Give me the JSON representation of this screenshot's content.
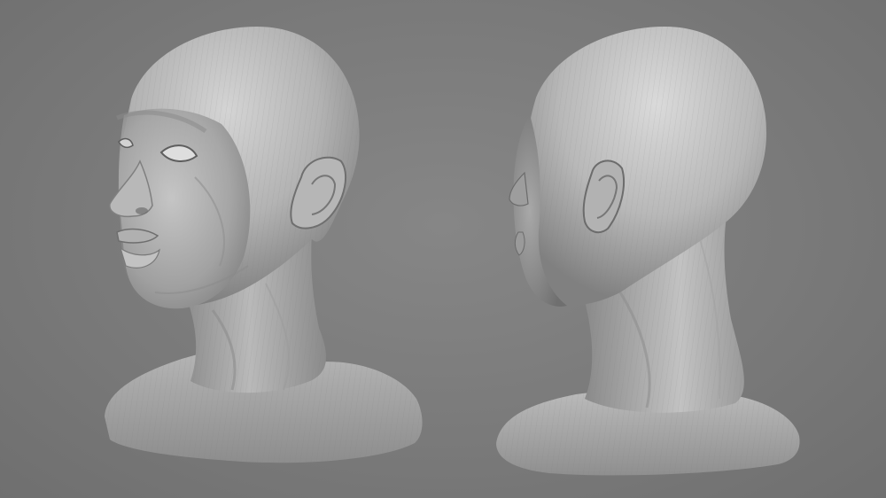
{
  "scene": {
    "background_color": "#7b7b7b",
    "material_color": "#bdbdbd",
    "subjects": [
      {
        "name": "sculpted-head-three-quarter-view"
      },
      {
        "name": "sculpted-head-back-three-quarter-view"
      }
    ]
  }
}
